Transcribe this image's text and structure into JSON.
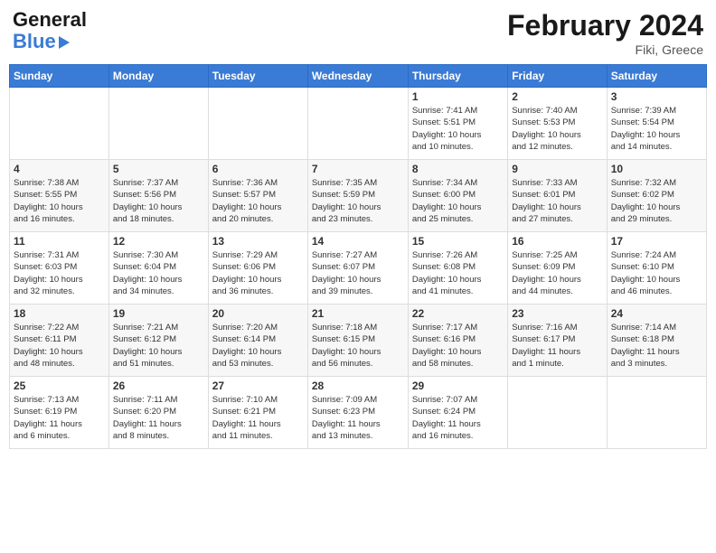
{
  "header": {
    "logo_text_general": "General",
    "logo_text_blue": "Blue",
    "month_title": "February 2024",
    "location": "Fiki, Greece"
  },
  "weekdays": [
    "Sunday",
    "Monday",
    "Tuesday",
    "Wednesday",
    "Thursday",
    "Friday",
    "Saturday"
  ],
  "weeks": [
    [
      {
        "day": "",
        "info": ""
      },
      {
        "day": "",
        "info": ""
      },
      {
        "day": "",
        "info": ""
      },
      {
        "day": "",
        "info": ""
      },
      {
        "day": "1",
        "info": "Sunrise: 7:41 AM\nSunset: 5:51 PM\nDaylight: 10 hours\nand 10 minutes."
      },
      {
        "day": "2",
        "info": "Sunrise: 7:40 AM\nSunset: 5:53 PM\nDaylight: 10 hours\nand 12 minutes."
      },
      {
        "day": "3",
        "info": "Sunrise: 7:39 AM\nSunset: 5:54 PM\nDaylight: 10 hours\nand 14 minutes."
      }
    ],
    [
      {
        "day": "4",
        "info": "Sunrise: 7:38 AM\nSunset: 5:55 PM\nDaylight: 10 hours\nand 16 minutes."
      },
      {
        "day": "5",
        "info": "Sunrise: 7:37 AM\nSunset: 5:56 PM\nDaylight: 10 hours\nand 18 minutes."
      },
      {
        "day": "6",
        "info": "Sunrise: 7:36 AM\nSunset: 5:57 PM\nDaylight: 10 hours\nand 20 minutes."
      },
      {
        "day": "7",
        "info": "Sunrise: 7:35 AM\nSunset: 5:59 PM\nDaylight: 10 hours\nand 23 minutes."
      },
      {
        "day": "8",
        "info": "Sunrise: 7:34 AM\nSunset: 6:00 PM\nDaylight: 10 hours\nand 25 minutes."
      },
      {
        "day": "9",
        "info": "Sunrise: 7:33 AM\nSunset: 6:01 PM\nDaylight: 10 hours\nand 27 minutes."
      },
      {
        "day": "10",
        "info": "Sunrise: 7:32 AM\nSunset: 6:02 PM\nDaylight: 10 hours\nand 29 minutes."
      }
    ],
    [
      {
        "day": "11",
        "info": "Sunrise: 7:31 AM\nSunset: 6:03 PM\nDaylight: 10 hours\nand 32 minutes."
      },
      {
        "day": "12",
        "info": "Sunrise: 7:30 AM\nSunset: 6:04 PM\nDaylight: 10 hours\nand 34 minutes."
      },
      {
        "day": "13",
        "info": "Sunrise: 7:29 AM\nSunset: 6:06 PM\nDaylight: 10 hours\nand 36 minutes."
      },
      {
        "day": "14",
        "info": "Sunrise: 7:27 AM\nSunset: 6:07 PM\nDaylight: 10 hours\nand 39 minutes."
      },
      {
        "day": "15",
        "info": "Sunrise: 7:26 AM\nSunset: 6:08 PM\nDaylight: 10 hours\nand 41 minutes."
      },
      {
        "day": "16",
        "info": "Sunrise: 7:25 AM\nSunset: 6:09 PM\nDaylight: 10 hours\nand 44 minutes."
      },
      {
        "day": "17",
        "info": "Sunrise: 7:24 AM\nSunset: 6:10 PM\nDaylight: 10 hours\nand 46 minutes."
      }
    ],
    [
      {
        "day": "18",
        "info": "Sunrise: 7:22 AM\nSunset: 6:11 PM\nDaylight: 10 hours\nand 48 minutes."
      },
      {
        "day": "19",
        "info": "Sunrise: 7:21 AM\nSunset: 6:12 PM\nDaylight: 10 hours\nand 51 minutes."
      },
      {
        "day": "20",
        "info": "Sunrise: 7:20 AM\nSunset: 6:14 PM\nDaylight: 10 hours\nand 53 minutes."
      },
      {
        "day": "21",
        "info": "Sunrise: 7:18 AM\nSunset: 6:15 PM\nDaylight: 10 hours\nand 56 minutes."
      },
      {
        "day": "22",
        "info": "Sunrise: 7:17 AM\nSunset: 6:16 PM\nDaylight: 10 hours\nand 58 minutes."
      },
      {
        "day": "23",
        "info": "Sunrise: 7:16 AM\nSunset: 6:17 PM\nDaylight: 11 hours\nand 1 minute."
      },
      {
        "day": "24",
        "info": "Sunrise: 7:14 AM\nSunset: 6:18 PM\nDaylight: 11 hours\nand 3 minutes."
      }
    ],
    [
      {
        "day": "25",
        "info": "Sunrise: 7:13 AM\nSunset: 6:19 PM\nDaylight: 11 hours\nand 6 minutes."
      },
      {
        "day": "26",
        "info": "Sunrise: 7:11 AM\nSunset: 6:20 PM\nDaylight: 11 hours\nand 8 minutes."
      },
      {
        "day": "27",
        "info": "Sunrise: 7:10 AM\nSunset: 6:21 PM\nDaylight: 11 hours\nand 11 minutes."
      },
      {
        "day": "28",
        "info": "Sunrise: 7:09 AM\nSunset: 6:23 PM\nDaylight: 11 hours\nand 13 minutes."
      },
      {
        "day": "29",
        "info": "Sunrise: 7:07 AM\nSunset: 6:24 PM\nDaylight: 11 hours\nand 16 minutes."
      },
      {
        "day": "",
        "info": ""
      },
      {
        "day": "",
        "info": ""
      }
    ]
  ]
}
